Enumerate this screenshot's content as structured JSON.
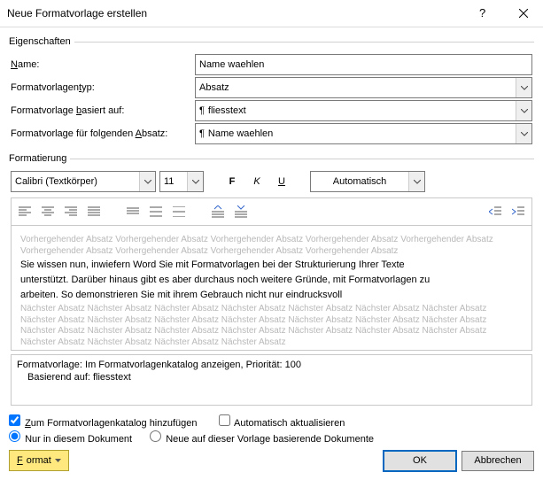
{
  "title": "Neue Formatvorlage erstellen",
  "groups": {
    "properties": "Eigenschaften",
    "formatting": "Formatierung"
  },
  "props": {
    "name_label": "Name:",
    "name_u": "N",
    "name_value": "Name waehlen",
    "type_label": "Formatvorlagentyp:",
    "type_u": "t",
    "type_value": "Absatz",
    "based_label": "Formatvorlage basiert auf:",
    "based_u": "b",
    "based_value": "fliesstext",
    "follow_label": "Formatvorlage für folgenden Absatz:",
    "follow_u": "A",
    "follow_value": "Name waehlen"
  },
  "font": {
    "family": "Calibri (Textkörper)",
    "size": "11",
    "bold": "F",
    "italic": "K",
    "underline": "U",
    "color": "Automatisch"
  },
  "preview": {
    "ghost_prev": "Vorhergehender Absatz Vorhergehender Absatz Vorhergehender Absatz Vorhergehender Absatz Vorhergehender Absatz Vorhergehender Absatz Vorhergehender Absatz Vorhergehender Absatz Vorhergehender Absatz",
    "para1": "Sie wissen nun, inwiefern Word Sie mit Formatvorlagen bei der Strukturierung Ihrer Texte",
    "para2": "unterstützt. Darüber hinaus gibt es aber durchaus noch weitere Gründe, mit Formatvorlagen zu",
    "para3": "arbeiten. So demonstrieren Sie mit ihrem Gebrauch nicht nur eindrucksvoll",
    "ghost_next": "Nächster Absatz Nächster Absatz Nächster Absatz Nächster Absatz Nächster Absatz Nächster Absatz Nächster Absatz Nächster Absatz Nächster Absatz Nächster Absatz Nächster Absatz Nächster Absatz Nächster Absatz Nächster Absatz Nächster Absatz Nächster Absatz Nächster Absatz Nächster Absatz Nächster Absatz Nächster Absatz Nächster Absatz Nächster Absatz Nächster Absatz Nächster Absatz Nächster Absatz"
  },
  "summary": {
    "line1": "Formatvorlage: Im Formatvorlagenkatalog anzeigen, Priorität: 100",
    "line2": "Basierend auf: fliesstext"
  },
  "checks": {
    "add": "Zum Formatvorlagenkatalog hinzufügen",
    "add_u": "Z",
    "auto": "Automatisch aktualisieren",
    "only": "Nur in diesem Dokument",
    "newtpl": "Neue auf dieser Vorlage basierende Dokumente"
  },
  "buttons": {
    "format": "Format",
    "ok": "OK",
    "cancel": "Abbrechen"
  }
}
